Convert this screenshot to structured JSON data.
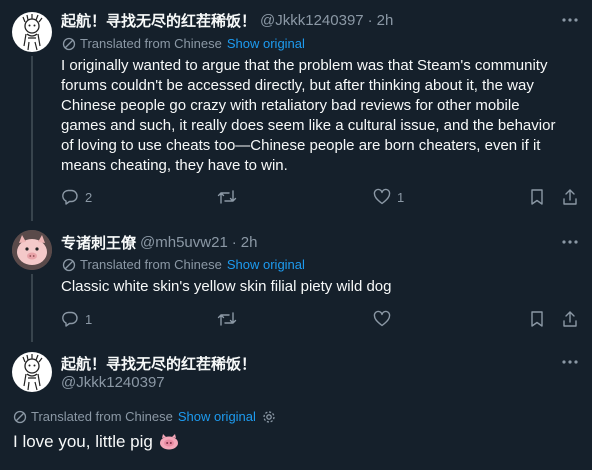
{
  "colors": {
    "background": "#15202b",
    "accent": "#1d9bf0",
    "muted": "#8b98a5"
  },
  "posts": [
    {
      "display_name": "起航！寻找无尽的红茬稀饭！",
      "handle": "@Jkkk1240397",
      "separator": "·",
      "time": "2h",
      "translated_label": "Translated from Chinese",
      "show_original": "Show original",
      "lines": [
        "I originally wanted to argue that the problem was that Steam's community",
        "forums couldn't be accessed directly, but after thinking about it, the way",
        "Chinese people go crazy with retaliatory bad reviews for other mobile",
        "games and such, it really does seem like a cultural issue, and the behavior",
        "of loving to use cheats too—Chinese people are born cheaters, even if it",
        "means cheating, they have to win."
      ],
      "replies": "2",
      "likes": "1"
    },
    {
      "display_name": "专诸刺王僚",
      "handle": "@mh5uvw21",
      "separator": "·",
      "time": "2h",
      "translated_label": "Translated from Chinese",
      "show_original": "Show original",
      "text": "Classic white skin's yellow skin filial piety wild dog",
      "replies": "1"
    }
  ],
  "focal": {
    "display_name": "起航！寻找无尽的红茬稀饭！",
    "handle": "@Jkkk1240397",
    "translated_label": "Translated from Chinese",
    "show_original": "Show original",
    "text": "I love you, little pig",
    "emoji": "pig-nose-emoji"
  }
}
